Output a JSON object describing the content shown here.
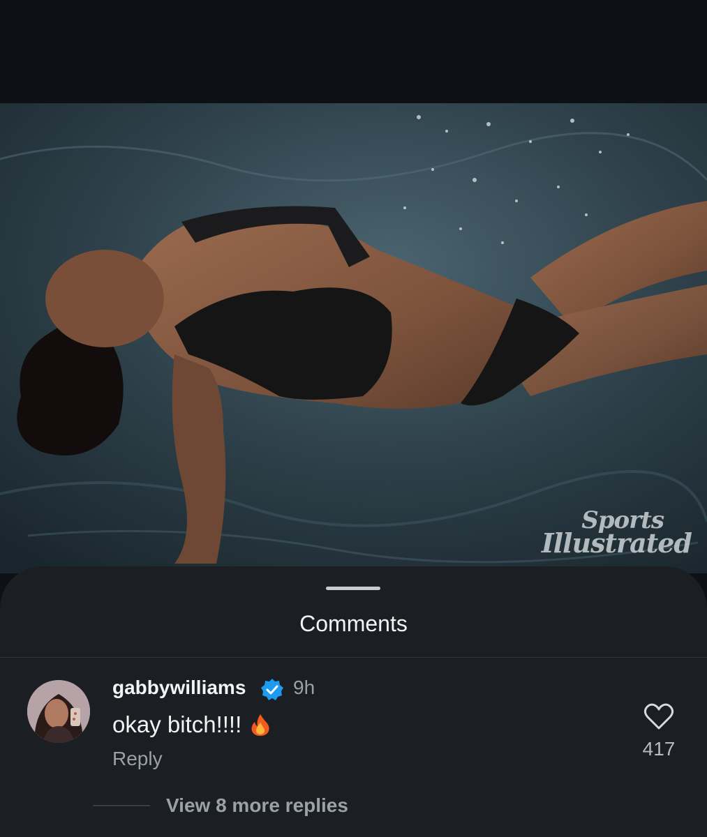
{
  "photo": {
    "watermark": {
      "line1": "Sports",
      "line2": "Illustrated"
    }
  },
  "comments_sheet": {
    "title": "Comments",
    "comment": {
      "username": "gabbywilliams",
      "verified": true,
      "time": "9h",
      "text": "okay bitch!!!!",
      "emoji": "fire-emoji",
      "reply_label": "Reply",
      "like_count": "417"
    },
    "view_replies_label": "View 8 more replies"
  },
  "colors": {
    "sheet_background": "#1b1e22",
    "screen_background": "#0d1015",
    "verified_blue": "#1d9bf0",
    "muted_text": "#9aa1a8"
  }
}
